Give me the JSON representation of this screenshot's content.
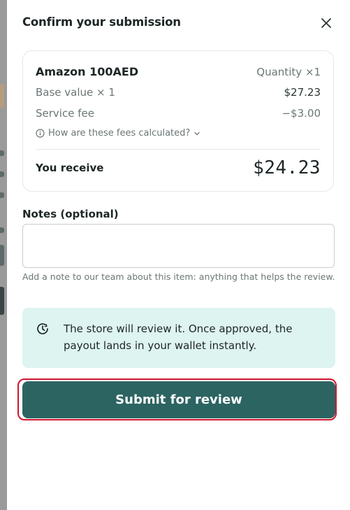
{
  "dialog": {
    "title": "Confirm your submission",
    "close_icon": "close-icon"
  },
  "summary": {
    "item_name": "Amazon 100AED",
    "quantity_label": "Quantity ×1",
    "base_value_label": "Base value × 1",
    "base_value": "$27.23",
    "service_fee_label": "Service fee",
    "service_fee": "−$3.00",
    "fees_link": "How are these fees calculated?",
    "receive_label": "You receive",
    "receive_amount": "$24.23"
  },
  "notes": {
    "label": "Notes (optional)",
    "value": "",
    "placeholder": "",
    "help": "Add a note to our team about this item: anything that helps the review."
  },
  "info": {
    "icon": "clock-check-icon",
    "text": "The store will review it. Once approved, the payout lands in your wallet instantly."
  },
  "submit": {
    "label": "Submit for review"
  },
  "colors": {
    "primary": "#2c6462",
    "info_bg": "#def4f1",
    "highlight": "#d0162d"
  }
}
